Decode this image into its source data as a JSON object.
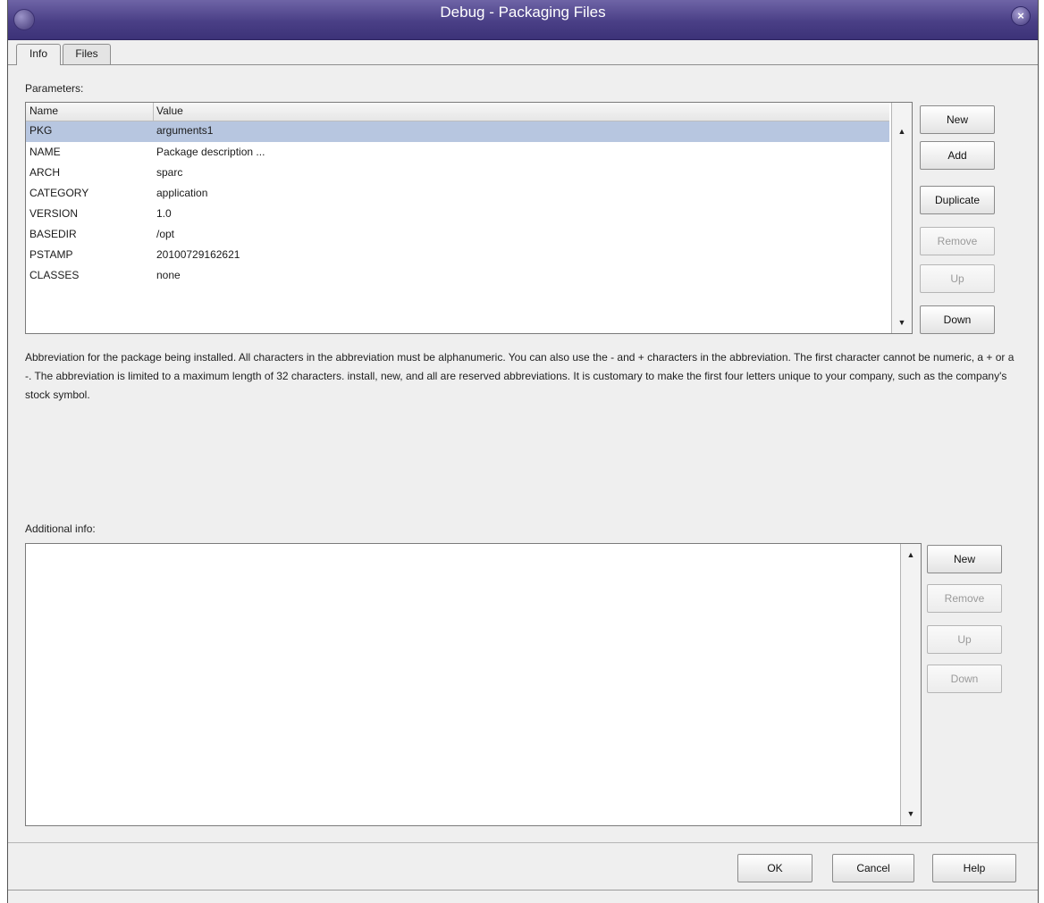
{
  "window": {
    "title": "Debug - Packaging Files"
  },
  "tabs": [
    {
      "label": "Info"
    },
    {
      "label": "Files"
    }
  ],
  "parameters": {
    "label": "Parameters:",
    "columns": [
      "Name",
      "Value"
    ],
    "rows": [
      {
        "name": "PKG",
        "value": "arguments1",
        "selected": true
      },
      {
        "name": "NAME",
        "value": "Package description ..."
      },
      {
        "name": "ARCH",
        "value": "sparc"
      },
      {
        "name": "CATEGORY",
        "value": "application"
      },
      {
        "name": "VERSION",
        "value": "1.0"
      },
      {
        "name": "BASEDIR",
        "value": "/opt"
      },
      {
        "name": "PSTAMP",
        "value": "20100729162621"
      },
      {
        "name": "CLASSES",
        "value": "none"
      }
    ],
    "buttons": {
      "new": "New",
      "add": "Add",
      "duplicate": "Duplicate",
      "remove": "Remove",
      "up": "Up",
      "down": "Down"
    }
  },
  "description": "Abbreviation for the package being installed. All characters in the abbreviation must be alphanumeric. You can also use the - and + characters in the abbreviation. The first character cannot be numeric, a + or a -. The abbreviation is limited to a maximum length of 32 characters. install, new, and all are reserved abbreviations. It is customary to make the first four letters unique to your company, such as the company's stock symbol.",
  "additional_info": {
    "label": "Additional info:",
    "buttons": {
      "new": "New",
      "remove": "Remove",
      "up": "Up",
      "down": "Down"
    }
  },
  "footer": {
    "ok": "OK",
    "cancel": "Cancel",
    "help": "Help"
  },
  "icons": {
    "scroll_up": "▲",
    "scroll_down": "▼",
    "close": "×"
  }
}
